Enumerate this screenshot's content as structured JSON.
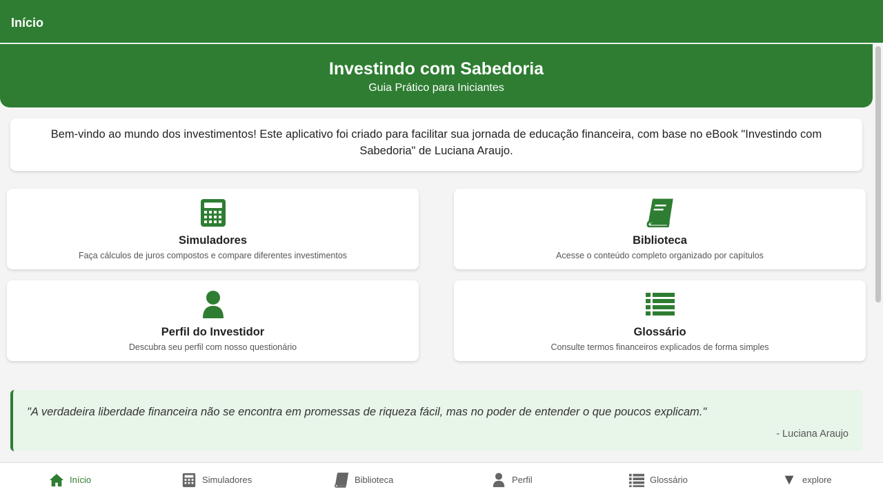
{
  "topbar": {
    "title": "Início"
  },
  "hero": {
    "title": "Investindo com Sabedoria",
    "subtitle": "Guia Prático para Iniciantes"
  },
  "welcome": {
    "text": "Bem-vindo ao mundo dos investimentos! Este aplicativo foi criado para facilitar sua jornada de educação financeira, com base no eBook \"Investindo com Sabedoria\" de Luciana Araujo."
  },
  "cards": [
    {
      "icon": "calculator-icon",
      "title": "Simuladores",
      "description": "Faça cálculos de juros compostos e compare diferentes investimentos"
    },
    {
      "icon": "book-icon",
      "title": "Biblioteca",
      "description": "Acesse o conteúdo completo organizado por capítulos"
    },
    {
      "icon": "user-icon",
      "title": "Perfil do Investidor",
      "description": "Descubra seu perfil com nosso questionário"
    },
    {
      "icon": "list-icon",
      "title": "Glossário",
      "description": "Consulte termos financeiros explicados de forma simples"
    }
  ],
  "quote": {
    "text": "\"A verdadeira liberdade financeira não se encontra em promessas de riqueza fácil, mas no poder de entender o que poucos explicam.\"",
    "author": "- Luciana Araujo"
  },
  "nav": [
    {
      "icon": "home-icon",
      "label": "Início",
      "active": true
    },
    {
      "icon": "calculator-icon",
      "label": "Simuladores",
      "active": false
    },
    {
      "icon": "book-icon",
      "label": "Biblioteca",
      "active": false
    },
    {
      "icon": "user-icon",
      "label": "Perfil",
      "active": false
    },
    {
      "icon": "list-icon",
      "label": "Glossário",
      "active": false
    },
    {
      "icon": "caret-down-icon",
      "label": "explore",
      "active": false
    }
  ],
  "colors": {
    "primary": "#2e7d32",
    "quote_bg": "#e8f5e9",
    "page_bg": "#f4f4f4",
    "nav_inactive": "#555555"
  }
}
